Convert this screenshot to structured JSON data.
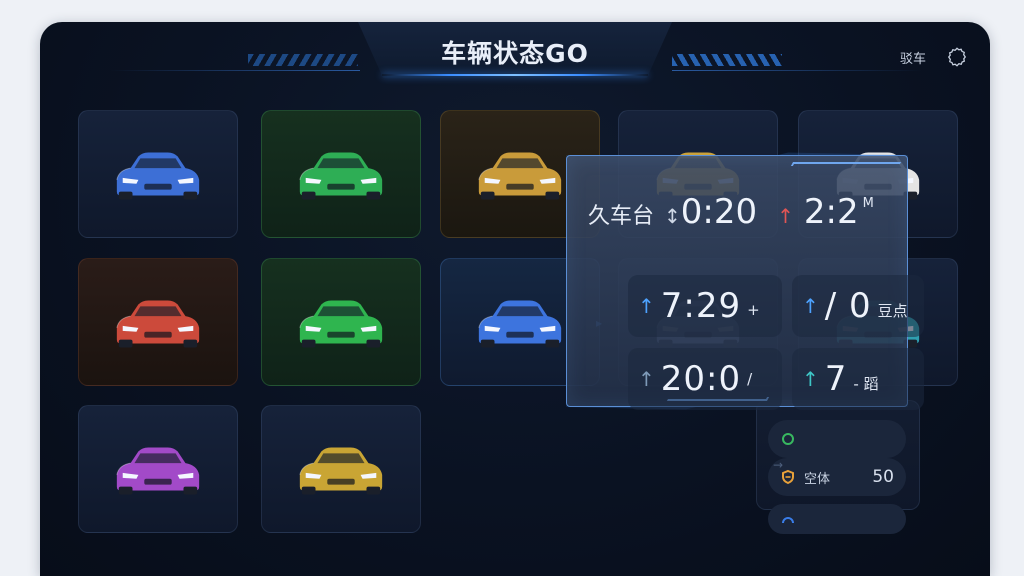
{
  "header": {
    "title": "车辆状态GO",
    "right_link": "驳车",
    "settings_icon": "gear-icon"
  },
  "vehicles": [
    {
      "id": "car-1",
      "color": "#3d6fd6",
      "tile": "neutral"
    },
    {
      "id": "car-2",
      "color": "#2eae55",
      "tile": "green"
    },
    {
      "id": "car-3",
      "color": "#c99b3a",
      "tile": "amber"
    },
    {
      "id": "car-4",
      "color": "#caa23a",
      "tile": "neutral"
    },
    {
      "id": "car-5",
      "color": "#e4e4e4",
      "tile": "neutral"
    },
    {
      "id": "car-6",
      "color": "#cc4a3b",
      "tile": "red"
    },
    {
      "id": "car-7",
      "color": "#2fb54f",
      "tile": "green"
    },
    {
      "id": "car-8",
      "color": "#3d74de",
      "tile": "blue"
    },
    {
      "id": "car-9",
      "color": "#6f80a8",
      "tile": "neutral"
    },
    {
      "id": "car-10",
      "color": "#2f9fb0",
      "tile": "neutral"
    },
    {
      "id": "car-11",
      "color": "#a24ac8",
      "tile": "neutral"
    },
    {
      "id": "car-12",
      "color": "#c9a534",
      "tile": "neutral"
    }
  ],
  "side_rows": [
    {
      "label": "空体",
      "value": "50",
      "icon": "shield-icon",
      "icon_color": "#e8a13a"
    },
    {
      "label": "",
      "value": "",
      "icon": "gauge-icon",
      "icon_color": "#3a7de8"
    }
  ],
  "panel": {
    "head_label": "久车台",
    "head_arrow": "↕",
    "head_value": "0:20",
    "head_arrow2": "↑",
    "head_value2": "2:2",
    "head_sup": "M",
    "cells": [
      {
        "arrow": "↑",
        "value": "7:29",
        "unit": "+"
      },
      {
        "arrow": "↑",
        "value": "/ 0",
        "unit": "豆点"
      },
      {
        "arrow": "↑",
        "value": "20:0",
        "unit": "/"
      },
      {
        "arrow": "↑",
        "value": "7",
        "unit": "- 蹈"
      }
    ]
  }
}
